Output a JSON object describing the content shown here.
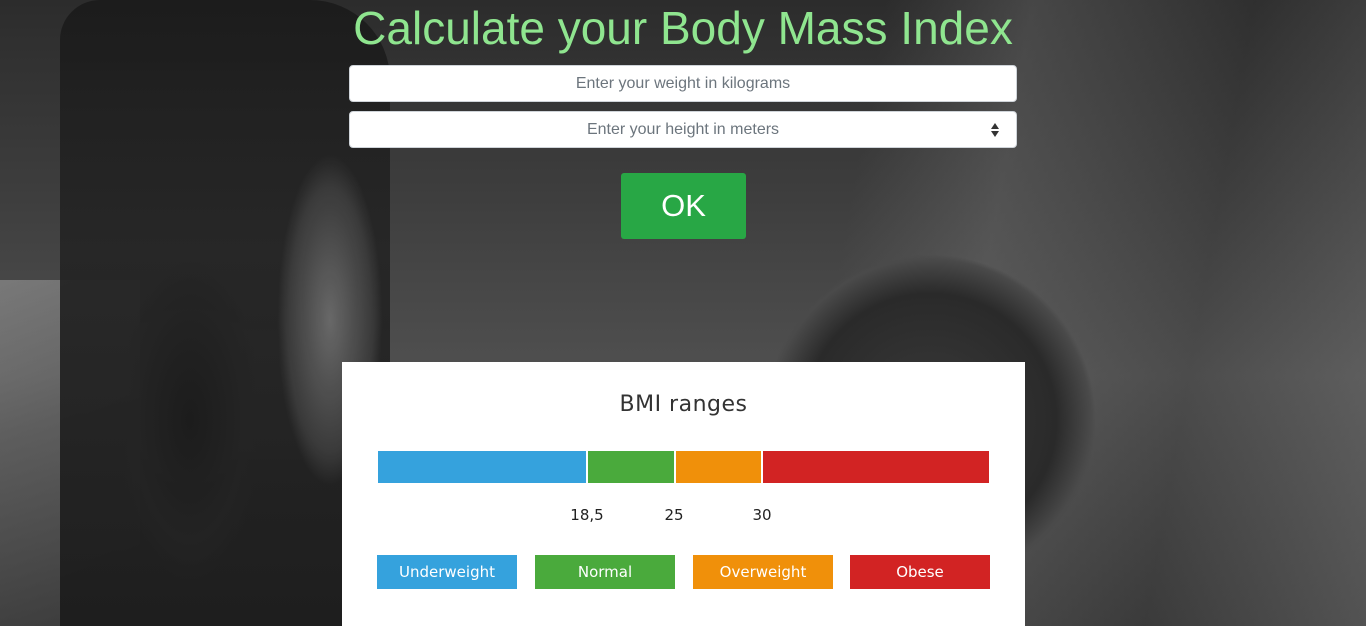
{
  "header": {
    "title": "Calculate your Body Mass Index"
  },
  "form": {
    "weight_placeholder": "Enter your weight in kilograms",
    "height_placeholder": "Enter your height in meters",
    "submit_label": "OK"
  },
  "bmi_panel": {
    "title": "BMI ranges",
    "thresholds": [
      "18,5",
      "25",
      "30"
    ],
    "categories": [
      {
        "label": "Underweight",
        "color": "#35a2dd"
      },
      {
        "label": "Normal",
        "color": "#4aaa3c"
      },
      {
        "label": "Overweight",
        "color": "#f0900a"
      },
      {
        "label": "Obese",
        "color": "#d22323"
      }
    ]
  },
  "colors": {
    "title_accent": "#8fe58f",
    "ok_button": "#28a745"
  }
}
